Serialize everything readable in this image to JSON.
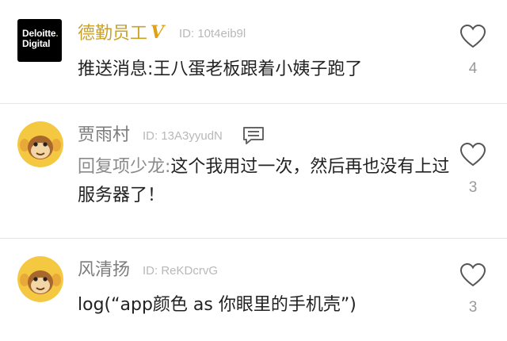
{
  "comments": [
    {
      "username": "德勤员工",
      "verified_mark": "V",
      "user_id": "ID: 10t4eib9l",
      "avatar_brand": {
        "line1": "Deloitte",
        "dot": ".",
        "line2": "Digital"
      },
      "text": "推送消息:王八蛋老板跟着小姨子跑了",
      "likes": "4"
    },
    {
      "username": "贾雨村",
      "user_id": "ID: 13A3yyudN",
      "reply_prefix": "回复项少龙:",
      "text": "这个我用过一次，然后再也没有上过服务器了！",
      "likes": "3"
    },
    {
      "username": "风清扬",
      "user_id": "ID: ReKDcrvG",
      "text": "log(“app颜色 as 你眼里的手机壳”)",
      "likes": "3"
    }
  ],
  "colors": {
    "verified_username": "#c9a227",
    "username": "#7d7d7d",
    "text": "#222222",
    "meta": "#b8b8b8",
    "avatar_face": "#f5c842"
  }
}
